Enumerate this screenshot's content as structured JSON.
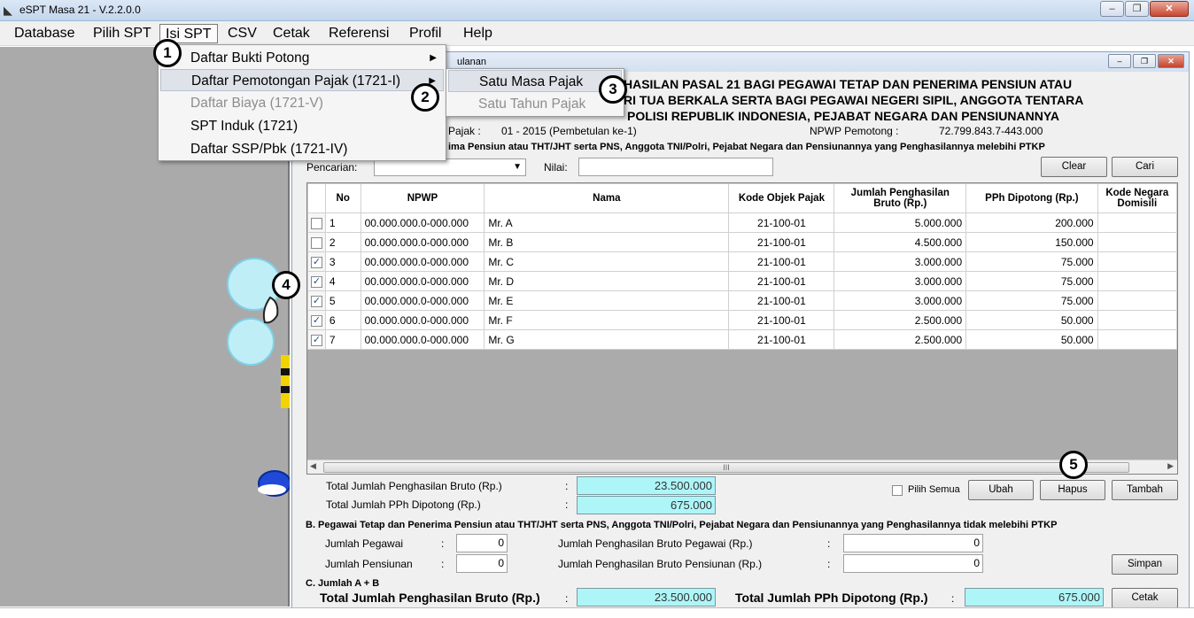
{
  "window": {
    "title": "eSPT Masa 21 - V.2.2.0.0",
    "controls": [
      "‒",
      "❐",
      "✕"
    ]
  },
  "menubar": [
    "Database",
    "Pilih SPT",
    "Isi SPT",
    "CSV",
    "Cetak",
    "Referensi",
    "Profil",
    "Help"
  ],
  "isi_spt_menu": [
    {
      "label": "Daftar Bukti Potong",
      "submenu": true,
      "disabled": false
    },
    {
      "label": "Daftar Pemotongan Pajak (1721-I)",
      "submenu": true,
      "disabled": false
    },
    {
      "label": "Daftar Biaya  (1721-V)",
      "submenu": false,
      "disabled": true
    },
    {
      "label": "SPT Induk  (1721)",
      "submenu": false,
      "disabled": false
    },
    {
      "label": "Daftar SSP/Pbk  (1721-IV)",
      "submenu": false,
      "disabled": false
    }
  ],
  "sub_menu": [
    {
      "label": "Satu Masa Pajak",
      "disabled": false
    },
    {
      "label": "Satu Tahun Pajak",
      "disabled": true
    }
  ],
  "callouts": [
    "1",
    "2",
    "3",
    "4",
    "5"
  ],
  "child": {
    "title_fragment": "ulanan",
    "heading_lines": [
      "HASILAN PASAL 21 BAGI PEGAWAI TETAP DAN PENERIMA PENSIUN ATAU",
      "RI TUA BERKALA SERTA BAGI PEGAWAI NEGERI SIPIL, ANGGOTA TENTARA",
      "POLISI REPUBLIK INDONESIA, PEJABAT NEGARA DAN PENSIUNANNYA"
    ],
    "masa_label": "Pajak :",
    "masa_value": "01 - 2015 (Pembetulan ke-1)",
    "npwp_label": "NPWP Pemotong :",
    "npwp_value": "72.799.843.7-443.000",
    "section_a": "ima Pensiun atau THT/JHT serta PNS, Anggota TNI/Polri, Pejabat Negara dan Pensiunannya yang Penghasilannya melebihi PTKP",
    "search_label": "Pencarian:",
    "nilai_label": "Nilai:",
    "clear_button": "Clear",
    "cari_button": "Cari"
  },
  "grid": {
    "columns": [
      "No",
      "NPWP",
      "Nama",
      "Kode Objek Pajak",
      "Jumlah Penghasilan Bruto (Rp.)",
      "PPh Dipotong (Rp.)",
      "Kode Negara Domisili"
    ],
    "rows": [
      {
        "checked": false,
        "no": "1",
        "npwp": "00.000.000.0-000.000",
        "nama": "Mr. A",
        "kode": "21-100-01",
        "bruto": "5.000.000",
        "pph": "200.000"
      },
      {
        "checked": false,
        "no": "2",
        "npwp": "00.000.000.0-000.000",
        "nama": "Mr. B",
        "kode": "21-100-01",
        "bruto": "4.500.000",
        "pph": "150.000"
      },
      {
        "checked": true,
        "no": "3",
        "npwp": "00.000.000.0-000.000",
        "nama": "Mr. C",
        "kode": "21-100-01",
        "bruto": "3.000.000",
        "pph": "75.000"
      },
      {
        "checked": true,
        "no": "4",
        "npwp": "00.000.000.0-000.000",
        "nama": "Mr. D",
        "kode": "21-100-01",
        "bruto": "3.000.000",
        "pph": "75.000"
      },
      {
        "checked": true,
        "no": "5",
        "npwp": "00.000.000.0-000.000",
        "nama": "Mr. E",
        "kode": "21-100-01",
        "bruto": "3.000.000",
        "pph": "75.000"
      },
      {
        "checked": true,
        "no": "6",
        "npwp": "00.000.000.0-000.000",
        "nama": "Mr. F",
        "kode": "21-100-01",
        "bruto": "2.500.000",
        "pph": "50.000"
      },
      {
        "checked": true,
        "no": "7",
        "npwp": "00.000.000.0-000.000",
        "nama": "Mr. G",
        "kode": "21-100-01",
        "bruto": "2.500.000",
        "pph": "50.000"
      }
    ],
    "scroll_grip": "III"
  },
  "totals_a": {
    "bruto_label": "Total Jumlah Penghasilan Bruto (Rp.)",
    "bruto_value": "23.500.000",
    "pph_label": "Total Jumlah PPh Dipotong (Rp.)",
    "pph_value": "675.000",
    "colon": ":"
  },
  "actions": {
    "pilih_semua": "Pilih Semua",
    "ubah": "Ubah",
    "hapus": "Hapus",
    "tambah": "Tambah"
  },
  "section_b": {
    "title": "B. Pegawai Tetap dan Penerima Pensiun atau THT/JHT serta PNS, Anggota TNI/Polri, Pejabat Negara dan Pensiunannya yang Penghasilannya tidak melebihi PTKP",
    "jml_pegawai_label": "Jumlah Pegawai",
    "jml_pegawai_value": "0",
    "jml_pensiunan_label": "Jumlah Pensiunan",
    "jml_pensiunan_value": "0",
    "bruto_pegawai_label": "Jumlah Penghasilan Bruto Pegawai (Rp.)",
    "bruto_pegawai_value": "0",
    "bruto_pensiunan_label": "Jumlah Penghasilan Bruto Pensiunan (Rp.)",
    "bruto_pensiunan_value": "0",
    "simpan": "Simpan"
  },
  "section_c": {
    "title": "C. Jumlah A + B",
    "bruto_label": "Total Jumlah Penghasilan Bruto (Rp.)",
    "bruto_value": "23.500.000",
    "pph_label": "Total Jumlah PPh Dipotong (Rp.)",
    "pph_value": "675.000",
    "cetak": "Cetak"
  },
  "colors": {
    "highlight_field": "#aef5f8",
    "left_pane": "#aaaaaa",
    "menu_highlight": "#dfe3e9"
  }
}
